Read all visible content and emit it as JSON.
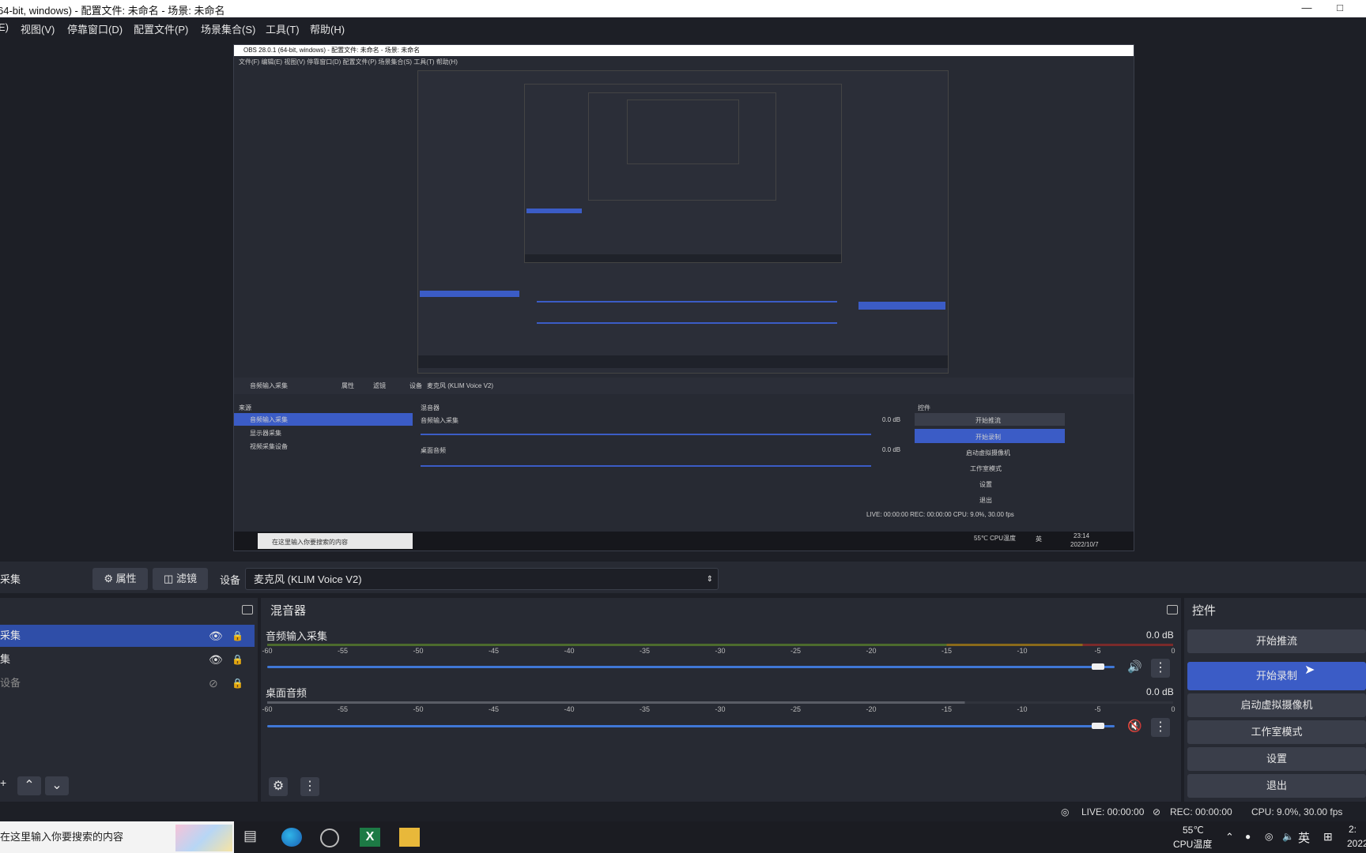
{
  "window": {
    "title": "64-bit, windows) - 配置文件: 未命名 - 场景: 未命名"
  },
  "menu": [
    "E)",
    "视图(V)",
    "停靠窗口(D)",
    "配置文件(P)",
    "场景集合(S)",
    "工具(T)",
    "帮助(H)"
  ],
  "preview": {
    "title": "OBS 28.0.1 (64-bit, windows) - 配置文件: 未命名 - 场景: 未命名",
    "menu": "文件(F)  编辑(E)  视图(V)  停靠窗口(D)  配置文件(P)  场景集合(S)  工具(T)  帮助(H)",
    "toolbar_source": "音频输入采集",
    "properties": "属性",
    "filters": "滤镜",
    "device_label": "设备",
    "device_value": "麦克风 (KLIM Voice V2)",
    "sources_title": "来源",
    "sources": [
      "音频输入采集",
      "显示器采集",
      "视频采集设备"
    ],
    "mixer_title": "混音器",
    "channel1": "音频输入采集",
    "channel2": "桌面音频",
    "db": "0.0 dB",
    "controls_title": "控件",
    "controls": [
      "开始推流",
      "开始录制",
      "启动虚拟摄像机",
      "工作室模式",
      "设置",
      "退出"
    ],
    "status": "LIVE: 00:00:00   REC: 00:00:00   CPU: 9.0%, 30.00 fps",
    "taskbar_search": "在这里输入你要搜索的内容",
    "temp": "55℃ CPU温度",
    "ime": "英",
    "time": "23:14",
    "date": "2022/10/7"
  },
  "toolbar": {
    "source_name": "采集",
    "properties_label": "属性",
    "filters_label": "滤镜",
    "device_label": "设备",
    "device_value": "麦克风 (KLIM Voice V2)"
  },
  "sources": {
    "items": [
      {
        "label": "采集",
        "visible": true,
        "selected": true
      },
      {
        "label": "集",
        "visible": true,
        "selected": false
      },
      {
        "label": "设备",
        "visible": false,
        "selected": false
      }
    ]
  },
  "mixer": {
    "title": "混音器",
    "ticks": [
      "-60",
      "-55",
      "-50",
      "-45",
      "-40",
      "-35",
      "-30",
      "-25",
      "-20",
      "-15",
      "-10",
      "-5",
      "0"
    ],
    "channels": [
      {
        "name": "音频输入采集",
        "db": "0.0 dB",
        "muted": false,
        "volume": 0.98
      },
      {
        "name": "桌面音频",
        "db": "0.0 dB",
        "muted": true,
        "volume": 0.98
      }
    ]
  },
  "controls": {
    "title": "控件",
    "buttons": [
      "开始推流",
      "开始录制",
      "启动虚拟摄像机",
      "工作室模式",
      "设置",
      "退出"
    ],
    "active_index": 1
  },
  "status": {
    "live": "LIVE: 00:00:00",
    "rec": "REC: 00:00:00",
    "cpu": "CPU: 9.0%, 30.00 fps"
  },
  "taskbar": {
    "search_placeholder": "在这里输入你要搜索的内容",
    "search_prefix": "在",
    "temp_value": "55℃",
    "temp_label": "CPU温度",
    "ime": "英",
    "clock_time": "2:",
    "clock_date": "2022"
  },
  "colors": {
    "accent": "#3b5cc6",
    "panel": "#272a33",
    "background": "#1d1f26",
    "button": "#3a3e4a"
  }
}
